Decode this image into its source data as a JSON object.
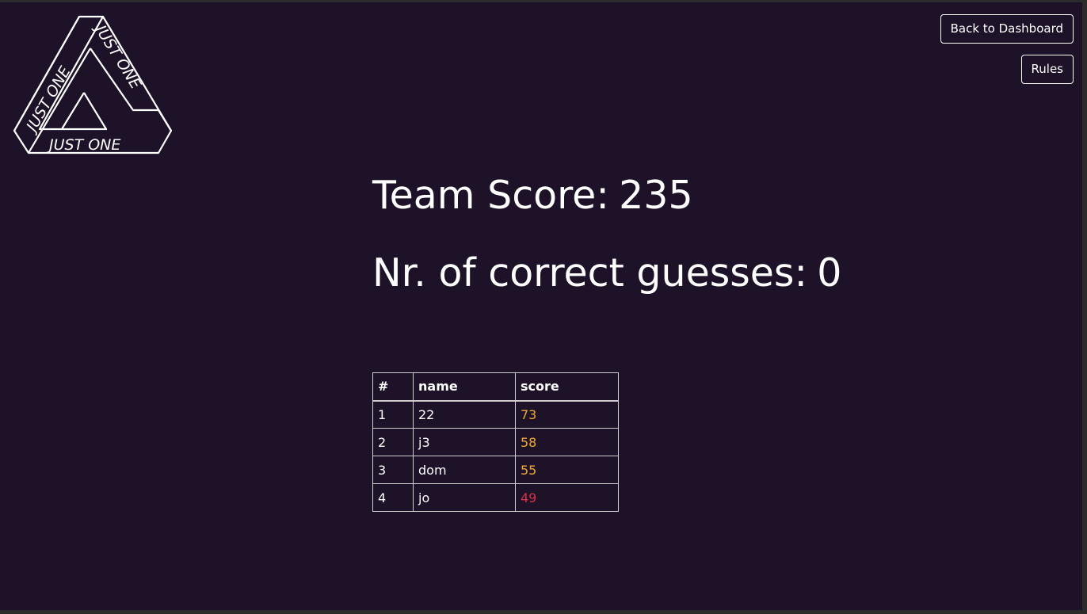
{
  "logo": {
    "text_top_right": "JUST ONE",
    "text_left": "JUST ONE",
    "text_bottom": "JUST ONE"
  },
  "header": {
    "dashboard_button": "Back to Dashboard",
    "rules_button": "Rules"
  },
  "summary": {
    "team_score_label": "Team Score:",
    "team_score_value": "235",
    "correct_guesses_label": "Nr. of correct guesses:",
    "correct_guesses_value": "0"
  },
  "ranking": {
    "columns": [
      "#",
      "name",
      "score"
    ],
    "rows": [
      {
        "rank": "1",
        "name": "22",
        "score": "73",
        "score_color": "#f0a830"
      },
      {
        "rank": "2",
        "name": "j3",
        "score": "58",
        "score_color": "#f0a830"
      },
      {
        "rank": "3",
        "name": "dom",
        "score": "55",
        "score_color": "#f0a830"
      },
      {
        "rank": "4",
        "name": "jo",
        "score": "49",
        "score_color": "#d9304a"
      }
    ]
  },
  "colors": {
    "background": "#1e1228",
    "text": "#ffffff",
    "score_high": "#f0a830",
    "score_low": "#d9304a"
  }
}
